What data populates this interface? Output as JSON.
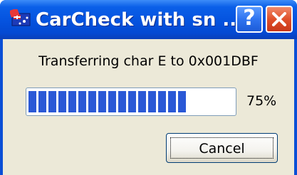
{
  "window": {
    "title": "CarCheck with sn ...",
    "icon": "app-icon",
    "help_button": "?",
    "close_button": "close-icon"
  },
  "dialog": {
    "message": "Transferring char E to 0x001DBF",
    "progress": {
      "value": 0.75,
      "label": "75%"
    },
    "cancel_label": "Cancel"
  },
  "colors": {
    "titlebar": "#0554e0",
    "progress_fill": "#2a58d6",
    "client_bg": "#ece9d8",
    "close_button": "#e0502a"
  }
}
